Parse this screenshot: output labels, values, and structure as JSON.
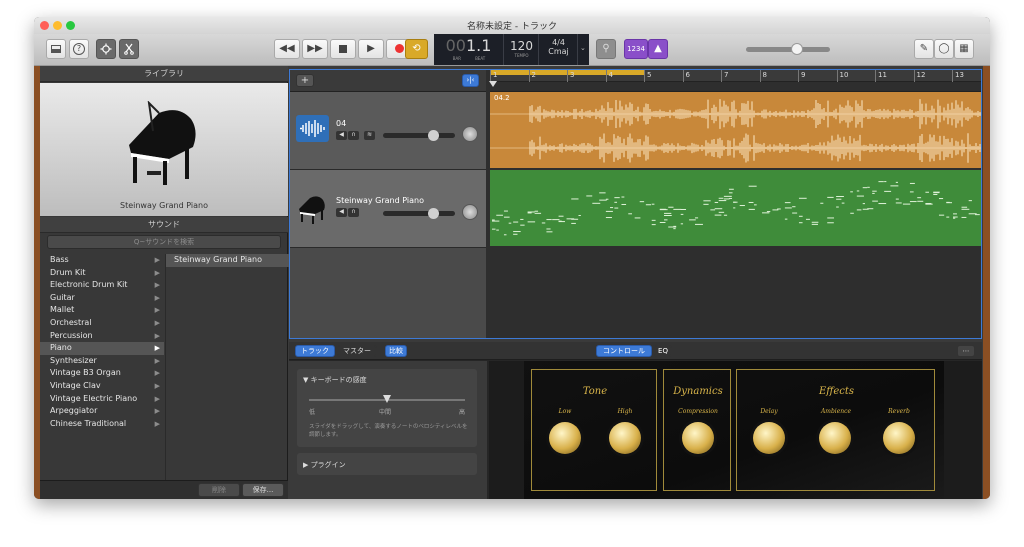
{
  "window": {
    "title": "名称未設定 - トラック"
  },
  "lcd": {
    "bar": "1",
    "beat": "1",
    "bar_prefix": "00",
    "bar_label": "BAR",
    "beat_label": "BEAT",
    "tempo": "120",
    "tempo_label": "TEMPO",
    "signature": "4/4",
    "key": "Cmaj"
  },
  "toolbar": {
    "count_in": "1234",
    "help": "?"
  },
  "library": {
    "header": "ライブラリ",
    "instrument_name": "Steinway Grand Piano",
    "sounds_header": "サウンド",
    "search_placeholder": "Q~サウンドを検索",
    "categories": [
      "Bass",
      "Drum Kit",
      "Electronic Drum Kit",
      "Guitar",
      "Mallet",
      "Orchestral",
      "Percussion",
      "Piano",
      "Synthesizer",
      "Vintage B3 Organ",
      "Vintage Clav",
      "Vintage Electric Piano",
      "Arpeggiator",
      "Chinese Traditional"
    ],
    "selected_category": "Piano",
    "patches": [
      "Steinway Grand Piano"
    ],
    "delete_button": "削除",
    "save_button": "保存..."
  },
  "tracks": [
    {
      "name": "04",
      "region_label": "04.2",
      "color": "#c8883a"
    },
    {
      "name": "Steinway Grand Piano",
      "color": "#3f8c3a"
    }
  ],
  "ruler": {
    "bars": [
      "1",
      "2",
      "3",
      "4",
      "5",
      "6",
      "7",
      "8",
      "9",
      "10",
      "11",
      "12",
      "13"
    ]
  },
  "bottom_tabs": [
    "トラック",
    "マスター",
    "比較"
  ],
  "smart_controls": {
    "tabs": [
      "コントロール",
      "EQ"
    ],
    "keyboard_section": "キーボードの感度",
    "slider_labels": [
      "低",
      "中間",
      "高"
    ],
    "slider_value": 0.5,
    "description": "スライダをドラッグして、演奏するノートのベロシティレベルを調節します。",
    "plugins_section": "プラグイン",
    "groups": [
      {
        "title": "Tone",
        "knobs": [
          "Low",
          "High"
        ]
      },
      {
        "title": "Dynamics",
        "knobs": [
          "Compression"
        ]
      },
      {
        "title": "Effects",
        "knobs": [
          "Delay",
          "Ambience",
          "Reverb"
        ]
      }
    ]
  },
  "master_volume": 0.62
}
